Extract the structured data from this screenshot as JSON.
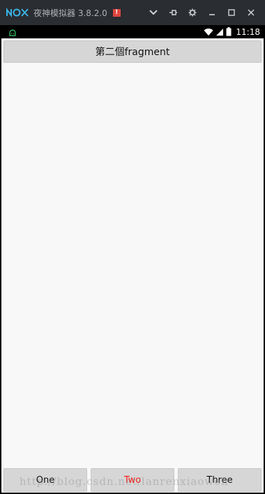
{
  "emulator": {
    "title": "夜神模拟器 3.8.2.0",
    "badge": "!",
    "controls": [
      "chevron-down-icon",
      "pin-icon",
      "gear-icon",
      "minimize-icon",
      "maximize-icon",
      "close-icon"
    ]
  },
  "status_bar": {
    "time": "11:18",
    "icons": [
      "android-debug-icon",
      "wifi-icon",
      "signal-icon",
      "battery-icon"
    ]
  },
  "app": {
    "fragment_label": "第二個fragment",
    "tabs": [
      {
        "label": "One",
        "active": false
      },
      {
        "label": "Two",
        "active": true
      },
      {
        "label": "Three",
        "active": false
      }
    ],
    "active_color": "#ff1a1a"
  },
  "watermark": "http://blog.csdn.net/lanrenxiaowen"
}
